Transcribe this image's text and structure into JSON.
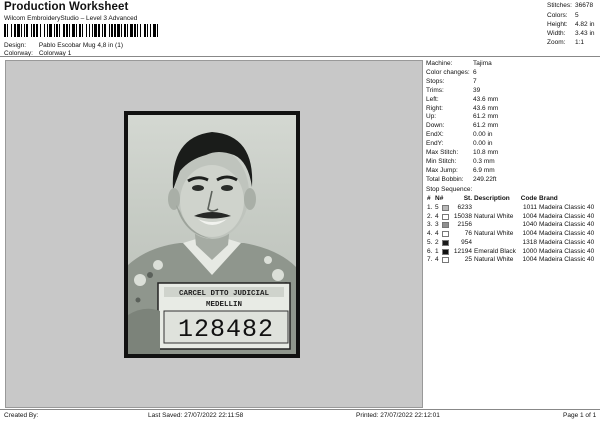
{
  "header": {
    "title": "Production Worksheet",
    "subtitle": "Wilcom EmbroideryStudio – Level 3 Advanced",
    "design_label": "Design:",
    "design_value": "Pablo Escobar Mug 4,8 in (1)",
    "colorway_label": "Colorway:",
    "colorway_value": "Colorway 1"
  },
  "stats": {
    "stitches_label": "Stitches:",
    "stitches_value": "36678",
    "colors_label": "Colors:",
    "colors_value": "5",
    "height_label": "Height:",
    "height_value": "4.82 in",
    "width_label": "Width:",
    "width_value": "3.43 in",
    "zoom_label": "Zoom:",
    "zoom_value": "1:1"
  },
  "machine_info": [
    {
      "label": "Machine:",
      "value": "Tajima"
    },
    {
      "label": "Color changes:",
      "value": "6"
    },
    {
      "label": "Stops:",
      "value": "7"
    },
    {
      "label": "Trims:",
      "value": "39"
    },
    {
      "label": "Left:",
      "value": "43.6 mm"
    },
    {
      "label": "Right:",
      "value": "43.6 mm"
    },
    {
      "label": "Up:",
      "value": "61.2 mm"
    },
    {
      "label": "Down:",
      "value": "61.2 mm"
    },
    {
      "label": "EndX:",
      "value": "0.00 in"
    },
    {
      "label": "EndY:",
      "value": "0.00 in"
    },
    {
      "label": "Max Stitch:",
      "value": "10.8 mm"
    },
    {
      "label": "Min Stitch:",
      "value": "0.3 mm"
    },
    {
      "label": "Max Jump:",
      "value": "6.9 mm"
    },
    {
      "label": "Total Bobbin:",
      "value": "249.22ft"
    }
  ],
  "stop_sequence": {
    "label": "Stop Sequence:",
    "headers": {
      "n": "#",
      "nnum": "N#",
      "st": "St.",
      "desc": "Description",
      "code": "Code",
      "brand": "Brand"
    },
    "rows": [
      {
        "n": "1.",
        "nnum": "5",
        "color": "#b8b8b8",
        "st": "6233",
        "desc": "",
        "code": "1011",
        "brand": "Madeira Classic 40"
      },
      {
        "n": "2.",
        "nnum": "4",
        "color": "#ffffff",
        "st": "15038",
        "desc": "Natural White",
        "code": "1004",
        "brand": "Madeira Classic 40"
      },
      {
        "n": "3.",
        "nnum": "3",
        "color": "#909090",
        "st": "2156",
        "desc": "",
        "code": "1040",
        "brand": "Madeira Classic 40"
      },
      {
        "n": "4.",
        "nnum": "4",
        "color": "#ffffff",
        "st": "76",
        "desc": "Natural White",
        "code": "1004",
        "brand": "Madeira Classic 40"
      },
      {
        "n": "5.",
        "nnum": "2",
        "color": "#1a1a1a",
        "st": "954",
        "desc": "",
        "code": "1318",
        "brand": "Madeira Classic 40"
      },
      {
        "n": "6.",
        "nnum": "1",
        "color": "#111111",
        "st": "12194",
        "desc": "Emerald Black",
        "code": "1000",
        "brand": "Madeira Classic 40"
      },
      {
        "n": "7.",
        "nnum": "4",
        "color": "#ffffff",
        "st": "25",
        "desc": "Natural White",
        "code": "1004",
        "brand": "Madeira Classic 40"
      }
    ]
  },
  "design_preview": {
    "sign_line1": "CARCEL DTTO JUDICIAL",
    "sign_line2": "MEDELLIN",
    "number": "128482"
  },
  "footer": {
    "created_by": "Created By:",
    "last_saved": "Last Saved: 27/07/2022 22:11:58",
    "printed": "Printed: 27/07/2022 22:12:01",
    "page": "Page 1 of 1"
  }
}
